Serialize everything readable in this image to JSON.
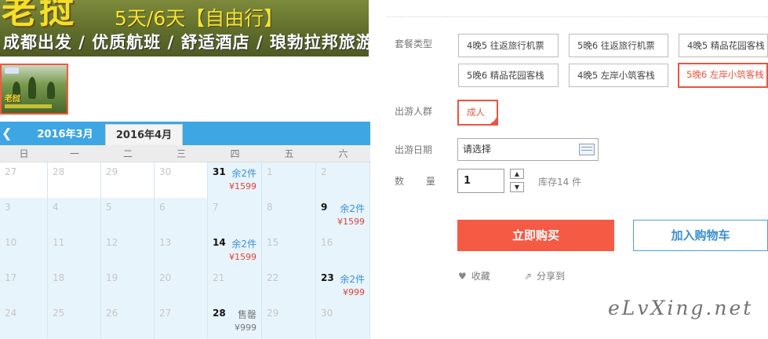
{
  "banner": {
    "big_text": "老挝",
    "days_text": "5天/6天【自由行】",
    "subtitle": "成都出发 / 优质航班 / 舒适酒店 / 琅勃拉邦旅游"
  },
  "thumbnail": {
    "caption": "老挝"
  },
  "calendar": {
    "months": [
      "2016年3月",
      "2016年4月"
    ],
    "weekdays": [
      "日",
      "一",
      "二",
      "三",
      "四",
      "五",
      "六"
    ],
    "rows": [
      [
        {
          "d": "27"
        },
        {
          "d": "28"
        },
        {
          "d": "29"
        },
        {
          "d": "30"
        },
        {
          "d": "31",
          "stock": "余2件",
          "price": "¥1599"
        },
        {
          "d": "1"
        },
        {
          "d": "2"
        }
      ],
      [
        {
          "d": "3"
        },
        {
          "d": "4"
        },
        {
          "d": "5"
        },
        {
          "d": "6"
        },
        {
          "d": "7"
        },
        {
          "d": "8"
        },
        {
          "d": "9",
          "stock": "余2件",
          "price": "¥1599"
        }
      ],
      [
        {
          "d": "10"
        },
        {
          "d": "11"
        },
        {
          "d": "12"
        },
        {
          "d": "13"
        },
        {
          "d": "14",
          "stock": "余2件",
          "price": "¥1599"
        },
        {
          "d": "15"
        },
        {
          "d": "16"
        }
      ],
      [
        {
          "d": "17"
        },
        {
          "d": "18"
        },
        {
          "d": "19"
        },
        {
          "d": "20"
        },
        {
          "d": "21"
        },
        {
          "d": "22"
        },
        {
          "d": "23",
          "stock": "余2件",
          "price": "¥999"
        }
      ],
      [
        {
          "d": "24"
        },
        {
          "d": "25"
        },
        {
          "d": "26"
        },
        {
          "d": "27"
        },
        {
          "d": "28",
          "stock": "售罄",
          "price": "¥999",
          "sold": true
        },
        {
          "d": "29"
        },
        {
          "d": "30"
        }
      ]
    ]
  },
  "form": {
    "package_label": "套餐类型",
    "package_options": [
      "4晚5 往返旅行机票",
      "5晚6 往返旅行机票",
      "4晚5 精品花园客栈",
      "5晚6 精品花园客栈",
      "4晚5 左岸小筑客栈",
      "5晚6 左岸小筑客栈"
    ],
    "group_label": "出游人群",
    "group_option": "成人",
    "date_label": "出游日期",
    "date_placeholder": "请选择",
    "qty_label": "数  量",
    "qty_value": "1",
    "stock_text": "库存14 件",
    "buy_label": "立即购买",
    "cart_label": "加入购物车",
    "favorite_label": "收藏",
    "share_label": "分享到"
  },
  "watermark": "eLvXing.net",
  "colors": {
    "accent": "#f55a45",
    "link": "#3a8fd0",
    "calendar_header": "#3da6e3"
  }
}
